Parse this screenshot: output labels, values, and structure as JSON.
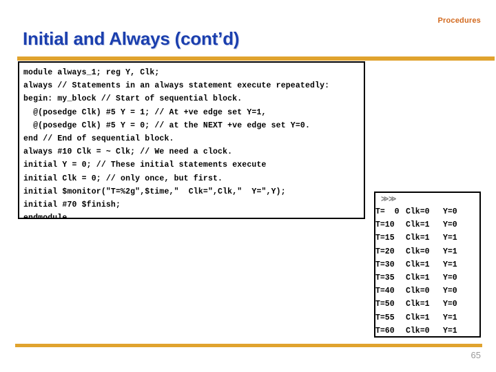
{
  "slide": {
    "section_label": "Procedures",
    "title": "Initial and Always (cont’d)",
    "page_number": "65",
    "accent_color": "#E0A32E",
    "title_color": "#1B3FAE",
    "section_label_color": "#D2691E",
    "page_number_color": "#9A9A9A",
    "background_color": "#FFFFFF"
  },
  "code_panel": {
    "language": "verilog",
    "lines": [
      "module always_1; reg Y, Clk;",
      "always // Statements in an always statement execute repeatedly:",
      "begin: my_block // Start of sequential block.",
      "  @(posedge Clk) #5 Y = 1; // At +ve edge set Y=1,",
      "  @(posedge Clk) #5 Y = 0; // at the NEXT +ve edge set Y=0.",
      "end // End of sequential block.",
      "always #10 Clk = ~ Clk; // We need a clock.",
      "initial Y = 0; // These initial statements execute",
      "initial Clk = 0; // only once, but first.",
      "initial $monitor(\"T=%2g\",$time,\"  Clk=\",Clk,\"  Y=\",Y);",
      "initial #70 $finish;",
      "endmodule"
    ]
  },
  "output_panel": {
    "marker": "≫≫",
    "marker_color": "#808080",
    "columns": [
      "T",
      "Clk",
      "Y"
    ],
    "rows": [
      {
        "t": "T=  0",
        "clk": "Clk=0",
        "y": "Y=0"
      },
      {
        "t": "T=10",
        "clk": "Clk=1",
        "y": "Y=0"
      },
      {
        "t": "T=15",
        "clk": "Clk=1",
        "y": "Y=1"
      },
      {
        "t": "T=20",
        "clk": "Clk=0",
        "y": "Y=1"
      },
      {
        "t": "T=30",
        "clk": "Clk=1",
        "y": "Y=1"
      },
      {
        "t": "T=35",
        "clk": "Clk=1",
        "y": "Y=0"
      },
      {
        "t": "T=40",
        "clk": "Clk=0",
        "y": "Y=0"
      },
      {
        "t": "T=50",
        "clk": "Clk=1",
        "y": "Y=0"
      },
      {
        "t": "T=55",
        "clk": "Clk=1",
        "y": "Y=1"
      },
      {
        "t": "T=60",
        "clk": "Clk=0",
        "y": "Y=1"
      }
    ]
  }
}
